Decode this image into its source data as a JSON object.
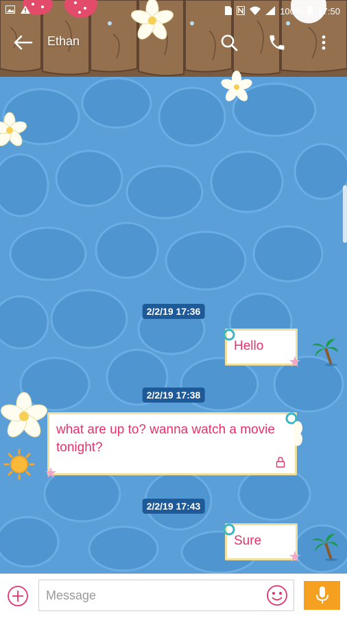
{
  "status_bar": {
    "battery": "100%",
    "time": "17:50",
    "icons": [
      "image-icon",
      "warning-icon",
      "sim-icon",
      "nfc-icon",
      "wifi-icon",
      "signal-icon",
      "battery-icon"
    ]
  },
  "toolbar": {
    "title": "Ethan",
    "icons": [
      "back-arrow-icon",
      "search-icon",
      "phone-icon",
      "more-vert-icon"
    ]
  },
  "conversation": [
    {
      "type": "timestamp",
      "text": "2/2/19 17:36"
    },
    {
      "type": "message",
      "direction": "outgoing",
      "text": "Hello"
    },
    {
      "type": "timestamp",
      "text": "2/2/19 17:38"
    },
    {
      "type": "message",
      "direction": "incoming",
      "text": "what are up to? wanna watch a movie tonight?",
      "icon": "lock-icon"
    },
    {
      "type": "timestamp",
      "text": "2/2/19 17:43"
    },
    {
      "type": "message",
      "direction": "outgoing",
      "text": "Sure"
    }
  ],
  "composer": {
    "placeholder": "Message",
    "icons": [
      "add-icon",
      "emoji-icon",
      "mic-icon"
    ]
  },
  "theme": {
    "water": "#5a9fd8",
    "deck": "#8a6a4c",
    "timestamp_bg": "#1f5a98",
    "message_text": "#e6326b",
    "bubble_border": "#f1df9e",
    "mic_button": "#f5a021"
  }
}
